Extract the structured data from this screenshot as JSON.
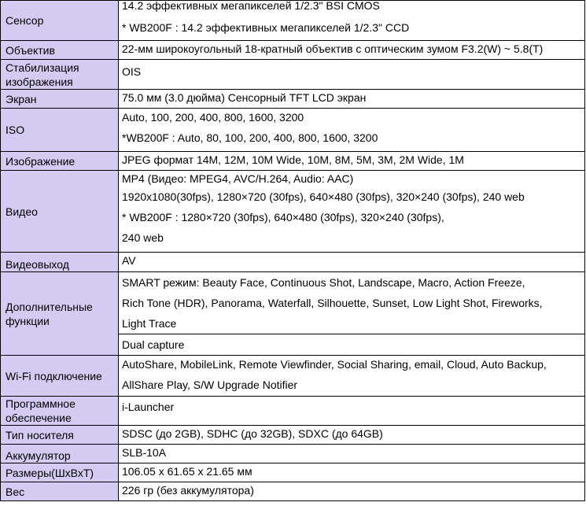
{
  "rows": [
    {
      "label": "Сенсор",
      "lines": [
        "14.2 эффективных мегапикселей 1/2.3\" BSI CMOS",
        "* WB200F : 14.2 эффективных мегапикселей 1/2.3\" CCD"
      ]
    },
    {
      "label": "Объектив",
      "lines": [
        "22-мм широкоугольный 18-кратный объектив с оптическим зумом F3.2(W) ~ 5.8(T)"
      ]
    },
    {
      "label": "Стабилизация изображения",
      "lines": [
        "OIS"
      ]
    },
    {
      "label": "Экран",
      "lines": [
        "75.0 мм (3.0 дюйма) Сенсорный TFT LCD экран"
      ]
    },
    {
      "label": "ISO",
      "lines": [
        "Auto, 100, 200, 400, 800, 1600, 3200",
        "*WB200F : Auto, 80, 100, 200, 400, 800, 1600, 3200"
      ]
    },
    {
      "label": "Изображение",
      "lines": [
        "JPEG формат  14M, 12M, 10M Wide, 10M, 8M, 5M, 3M, 2M Wide, 1M"
      ]
    },
    {
      "label": "Видео",
      "lines": [
        "MP4 (Видео: MPEG4, AVC/H.264, Audio: AAC)",
        "1920x1080(30fps), 1280×720 (30fps), 640×480 (30fps), 320×240 (30fps), 240 web",
        "* WB200F : 1280×720 (30fps), 640×480 (30fps), 320×240 (30fps),",
        "240 web"
      ]
    },
    {
      "label": "Видеовыход",
      "lines": [
        "AV"
      ]
    },
    {
      "label": "Дополнительные функции",
      "lines": [
        "SMART режим: Beauty Face, Continuous Shot, Landscape, Macro, Action Freeze,",
        "Rich Tone (HDR), Panorama, Waterfall, Silhouette, Sunset, Low Light Shot, Fireworks,",
        "Light Trace"
      ],
      "extra": "Dual capture"
    },
    {
      "label": "Wi-Fi подключение",
      "lines": [
        "AutoShare, MobileLink, Remote Viewfinder, Social Sharing, email, Cloud, Auto Backup,",
        "AllShare Play, S/W Upgrade Notifier"
      ]
    },
    {
      "label": "Программное обеспечение",
      "lines": [
        "i-Launcher"
      ]
    },
    {
      "label": "Тип носителя",
      "lines": [
        "SDSC (до 2GB), SDHC (до 32GB), SDXC (до 64GB)"
      ]
    },
    {
      "label": "Аккумулятор",
      "lines": [
        "SLB-10A"
      ]
    },
    {
      "label": "Размеры(ШхВхТ)",
      "lines": [
        "106.05 x 61.65 x 21.65 мм"
      ]
    },
    {
      "label": "Вес",
      "lines": [
        "226 гр (без аккумулятора)"
      ]
    }
  ]
}
